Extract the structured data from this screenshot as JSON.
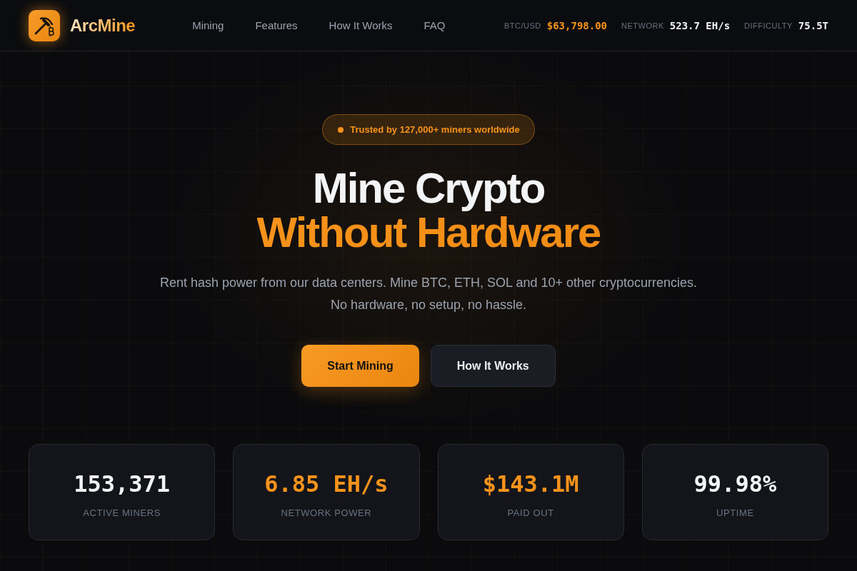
{
  "header": {
    "brand": "ArcMine",
    "nav": [
      "Mining",
      "Features",
      "How It Works",
      "FAQ"
    ],
    "ticker": [
      {
        "label": "BTC/USD",
        "value": "$63,798.00",
        "highlight": true
      },
      {
        "label": "NETWORK",
        "value": "523.7 EH/s",
        "highlight": false
      },
      {
        "label": "DIFFICULTY",
        "value": "75.5T",
        "highlight": false
      }
    ]
  },
  "hero": {
    "badge": "Trusted by 127,000+ miners worldwide",
    "headline": [
      {
        "text": "Mine Crypto",
        "highlight": false
      },
      {
        "text": "Without Hardware",
        "highlight": true
      }
    ],
    "subtitle": [
      "Rent hash power from our data centers. Mine BTC, ETH, SOL and 10+ other cryptocurrencies.",
      "No hardware, no setup, no hassle."
    ],
    "buttons": [
      {
        "label": "Start Mining",
        "kind": "primary"
      },
      {
        "label": "How It Works",
        "kind": "secondary"
      }
    ]
  },
  "stats": [
    {
      "value": "153,371",
      "label": "ACTIVE MINERS",
      "highlight": false
    },
    {
      "value": "6.85 EH/s",
      "label": "NETWORK POWER",
      "highlight": true
    },
    {
      "value": "$143.1M",
      "label": "PAID OUT",
      "highlight": true
    },
    {
      "value": "99.98%",
      "label": "UPTIME",
      "highlight": false
    }
  ]
}
